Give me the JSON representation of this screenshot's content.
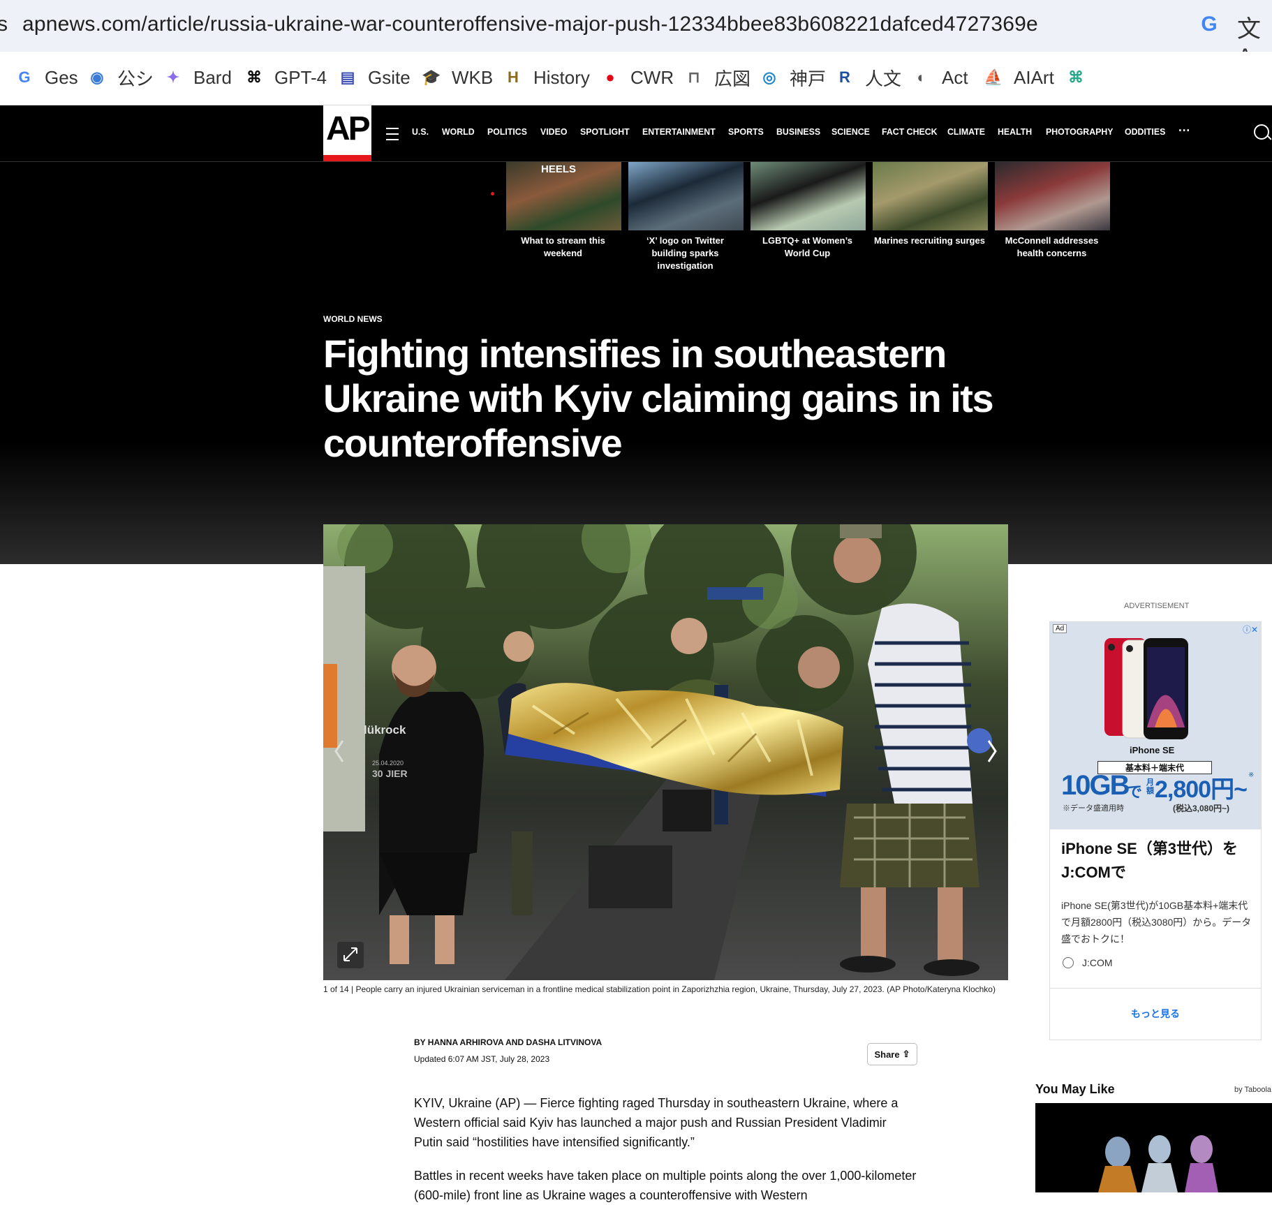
{
  "browser": {
    "url": "apnews.com/article/russia-ukraine-war-counteroffensive-major-push-12334bbee83b608221dafced4727369e",
    "url_left_glyph": "s",
    "bookmarks": [
      {
        "label": "Ges",
        "icon": "google-g-icon",
        "color": "#4285f4",
        "glyph": "G"
      },
      {
        "label": "公シ",
        "icon": "blue-circle-icon",
        "color": "#3a7bd5",
        "glyph": "◉"
      },
      {
        "label": "Bard",
        "icon": "sparkle-icon",
        "color": "#8a6ee8",
        "glyph": "✦"
      },
      {
        "label": "GPT-4",
        "icon": "openai-icon",
        "color": "#111111",
        "glyph": "⌘"
      },
      {
        "label": "Gsite",
        "icon": "google-sites-icon",
        "color": "#3f51b5",
        "glyph": "▤"
      },
      {
        "label": "WKB",
        "icon": "graduation-cap-icon",
        "color": "#1a4ca1",
        "glyph": "🎓"
      },
      {
        "label": "History",
        "icon": "history-channel-icon",
        "color": "#8b6b1f",
        "glyph": "H"
      },
      {
        "label": "CWR",
        "icon": "red-circle-icon",
        "color": "#e30613",
        "glyph": "●"
      },
      {
        "label": "広図",
        "icon": "library-icon",
        "color": "#666666",
        "glyph": "⊓"
      },
      {
        "label": "神戸",
        "icon": "eye-icon",
        "color": "#1e88c8",
        "glyph": "◎"
      },
      {
        "label": "人文",
        "icon": "r-logo-icon",
        "color": "#1f4fa0",
        "glyph": "R"
      },
      {
        "label": "Act",
        "icon": "globe-icon",
        "color": "#555555",
        "glyph": "◐"
      },
      {
        "label": "AIArt",
        "icon": "sailboat-icon",
        "color": "#666666",
        "glyph": "⛵"
      },
      {
        "label": "",
        "icon": "openai-green-icon",
        "color": "#2aa88a",
        "glyph": "⌘"
      }
    ]
  },
  "nav": {
    "logo": "AP",
    "items": [
      "U.S.",
      "WORLD",
      "POLITICS",
      "VIDEO",
      "SPOTLIGHT",
      "ENTERTAINMENT",
      "SPORTS",
      "BUSINESS",
      "SCIENCE",
      "FACT CHECK",
      "CLIMATE",
      "HEALTH",
      "PHOTOGRAPHY",
      "ODDITIES"
    ],
    "more": "···"
  },
  "thumbs": [
    {
      "caption": "What to stream this weekend",
      "palette": [
        "#3b3a2a",
        "#8a5a3c",
        "#2e4a2a",
        "#6b5b3a"
      ],
      "overlay": "HEELS"
    },
    {
      "caption": "‘X’ logo on Twitter building sparks investigation",
      "palette": [
        "#7fa6c8",
        "#1c2a38",
        "#5c6d7a",
        "#3e4a52"
      ],
      "overlay": ""
    },
    {
      "caption": "LGBTQ+ at Women’s World Cup",
      "palette": [
        "#6e8c78",
        "#1a1a1a",
        "#b7c9b0",
        "#8fa89b"
      ],
      "overlay": ""
    },
    {
      "caption": "Marines recruiting surges",
      "palette": [
        "#6a7b4a",
        "#a49a6c",
        "#3d4a2a",
        "#8b8a5a"
      ],
      "overlay": ""
    },
    {
      "caption": "McConnell addresses health concerns",
      "palette": [
        "#2b2a2e",
        "#8a3a3a",
        "#b09890",
        "#3a3840"
      ],
      "overlay": ""
    }
  ],
  "article": {
    "kicker": "WORLD NEWS",
    "headline": "Fighting intensifies in southeastern Ukraine with Kyiv claiming gains in its counteroffensive",
    "caption": "1 of 14 | People carry an injured Ukrainian serviceman in a frontline medical stabilization point in Zaporizhzhia region, Ukraine, Thursday, July 27, 2023. (AP Photo/Kateryna Klochko)",
    "photo_shirt_text": "lükrock",
    "photo_shirt_sub": "25.04.2020",
    "photo_shirt_big": "30 JIER",
    "byline": "BY HANNA ARHIROVA AND DASHA LITVINOVA",
    "updated": "Updated 6:07 AM JST, July 28, 2023",
    "share": "Share",
    "paragraphs": [
      "KYIV, Ukraine (AP) — Fierce fighting raged Thursday in southeastern Ukraine, where a Western official said Kyiv has launched a major push and Russian President Vladimir Putin said “hostilities have intensified significantly.”",
      "Battles in recent weeks have taken place on multiple points along the over 1,000-kilometer (600-mile) front line as Ukraine wages a counteroffensive with Western"
    ]
  },
  "ad": {
    "label": "ADVERTISEMENT",
    "badge": "Ad",
    "brand_line": "iPhone SE",
    "plan_box": "基本料＋端末代",
    "gb": "10GB",
    "de": "で",
    "monthly": "月額",
    "price": "2,800円~",
    "note1": "※データ盛適用時",
    "note2": "(税込3,080円~)",
    "asterisk": "※",
    "title": "iPhone SE（第3世代）をJ:COMで",
    "desc": "iPhone SE(第3世代)が10GB基本料+端末代で月額2800円（税込3080円）から。データ盛でおトクに！",
    "advertiser": "J:COM",
    "more": "もっと見る",
    "link_color": "#1a73e8"
  },
  "sidebar": {
    "you_may_like": "You May Like",
    "by_taboola": "by Taboola"
  },
  "colors": {
    "ap_red": "#e5171b",
    "nav_bg": "#000000"
  }
}
